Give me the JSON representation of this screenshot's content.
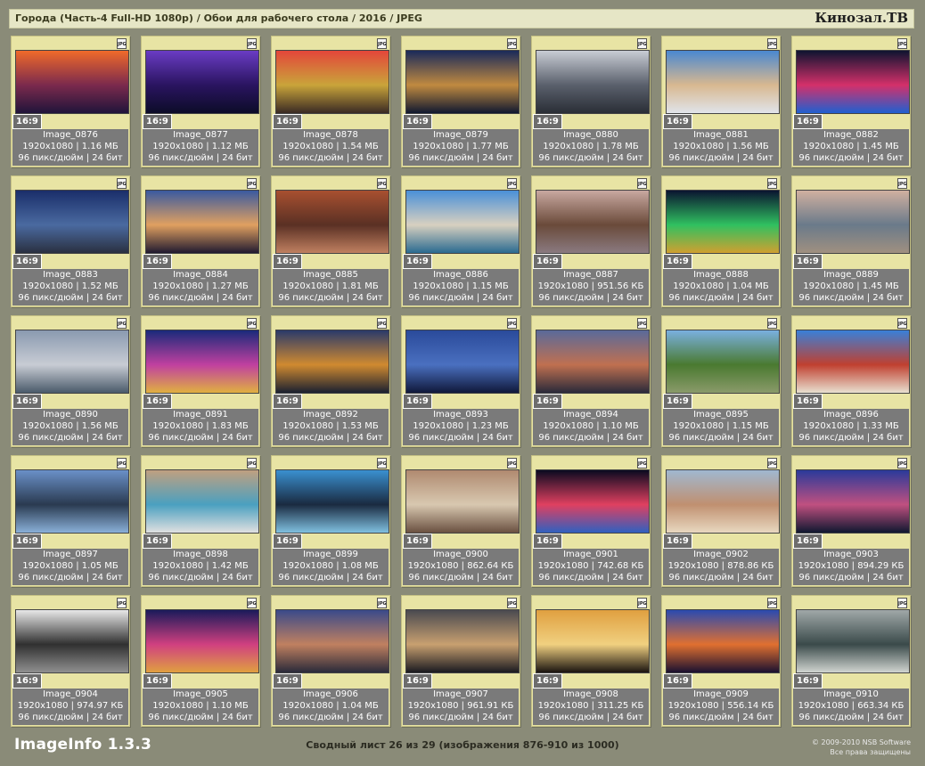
{
  "header": {
    "title": "Города (Часть-4 Full-HD 1080p) / Обои для рабочего стола / 2016 / JPEG",
    "brand": "Кинозал.ТВ"
  },
  "icon_label": "JPG",
  "items": [
    {
      "name": "Image_0876",
      "size": "1920x1080 | 1.16 МБ",
      "dpi": "96 пикс/дюйм | 24 бит",
      "ratio": "16:9",
      "colors": [
        "#f06a2a",
        "#7b2a4d",
        "#20143a"
      ]
    },
    {
      "name": "Image_0877",
      "size": "1920x1080 | 1.12 МБ",
      "dpi": "96 пикс/дюйм | 24 бит",
      "ratio": "16:9",
      "colors": [
        "#6a3cc4",
        "#2a1460",
        "#0c0c28"
      ]
    },
    {
      "name": "Image_0878",
      "size": "1920x1080 | 1.54 МБ",
      "dpi": "96 пикс/дюйм | 24 бит",
      "ratio": "16:9",
      "colors": [
        "#e4463a",
        "#c9a43a",
        "#3a2a24"
      ]
    },
    {
      "name": "Image_0879",
      "size": "1920x1080 | 1.77 МБ",
      "dpi": "96 пикс/дюйм | 24 бит",
      "ratio": "16:9",
      "colors": [
        "#1a2a5a",
        "#c08a40",
        "#101830"
      ]
    },
    {
      "name": "Image_0880",
      "size": "1920x1080 | 1.78 МБ",
      "dpi": "96 пикс/дюйм | 24 бит",
      "ratio": "16:9",
      "colors": [
        "#c8ccd4",
        "#5a606c",
        "#2a2e36"
      ]
    },
    {
      "name": "Image_0881",
      "size": "1920x1080 | 1.56 МБ",
      "dpi": "96 пикс/дюйм | 24 бит",
      "ratio": "16:9",
      "colors": [
        "#4a88d0",
        "#d8b890",
        "#e0e4ea"
      ]
    },
    {
      "name": "Image_0882",
      "size": "1920x1080 | 1.45 МБ",
      "dpi": "96 пикс/дюйм | 24 бит",
      "ratio": "16:9",
      "colors": [
        "#0e1430",
        "#d4306a",
        "#2060d0"
      ]
    },
    {
      "name": "Image_0883",
      "size": "1920x1080 | 1.52 МБ",
      "dpi": "96 пикс/дюйм | 24 бит",
      "ratio": "16:9",
      "colors": [
        "#1a2e6a",
        "#4a6aa0",
        "#2a3040"
      ]
    },
    {
      "name": "Image_0884",
      "size": "1920x1080 | 1.27 МБ",
      "dpi": "96 пикс/дюйм | 24 бит",
      "ratio": "16:9",
      "colors": [
        "#3a5aa0",
        "#e0a060",
        "#201a30"
      ]
    },
    {
      "name": "Image_0885",
      "size": "1920x1080 | 1.81 МБ",
      "dpi": "96 пикс/дюйм | 24 бит",
      "ratio": "16:9",
      "colors": [
        "#a85030",
        "#5a3024",
        "#c08060"
      ]
    },
    {
      "name": "Image_0886",
      "size": "1920x1080 | 1.15 МБ",
      "dpi": "96 пикс/дюйм | 24 бит",
      "ratio": "16:9",
      "colors": [
        "#4a90d8",
        "#d8d0c0",
        "#2a6a90"
      ]
    },
    {
      "name": "Image_0887",
      "size": "1920x1080 | 951.56 КБ",
      "dpi": "96 пикс/дюйм | 24 бит",
      "ratio": "16:9",
      "colors": [
        "#c8a8a0",
        "#6a4a3a",
        "#8a7a80"
      ]
    },
    {
      "name": "Image_0888",
      "size": "1920x1080 | 1.04 МБ",
      "dpi": "96 пикс/дюйм | 24 бит",
      "ratio": "16:9",
      "colors": [
        "#0a1430",
        "#30c060",
        "#d0a030"
      ]
    },
    {
      "name": "Image_0889",
      "size": "1920x1080 | 1.45 МБ",
      "dpi": "96 пикс/дюйм | 24 бит",
      "ratio": "16:9",
      "colors": [
        "#d0b0a0",
        "#6a7a8a",
        "#a09080"
      ]
    },
    {
      "name": "Image_0890",
      "size": "1920x1080 | 1.56 МБ",
      "dpi": "96 пикс/дюйм | 24 бит",
      "ratio": "16:9",
      "colors": [
        "#8a9ab0",
        "#c8ccd4",
        "#4a5a6a"
      ]
    },
    {
      "name": "Image_0891",
      "size": "1920x1080 | 1.83 МБ",
      "dpi": "96 пикс/дюйм | 24 бит",
      "ratio": "16:9",
      "colors": [
        "#1a2a7a",
        "#c040a0",
        "#e0b040"
      ]
    },
    {
      "name": "Image_0892",
      "size": "1920x1080 | 1.53 МБ",
      "dpi": "96 пикс/дюйм | 24 бит",
      "ratio": "16:9",
      "colors": [
        "#2a3a6a",
        "#d08a30",
        "#1a2030"
      ]
    },
    {
      "name": "Image_0893",
      "size": "1920x1080 | 1.23 МБ",
      "dpi": "96 пикс/дюйм | 24 бит",
      "ratio": "16:9",
      "colors": [
        "#2a4a9a",
        "#4a70c0",
        "#10183a"
      ]
    },
    {
      "name": "Image_0894",
      "size": "1920x1080 | 1.10 МБ",
      "dpi": "96 пикс/дюйм | 24 бит",
      "ratio": "16:9",
      "colors": [
        "#5a6a9a",
        "#c07050",
        "#2a2a3a"
      ]
    },
    {
      "name": "Image_0895",
      "size": "1920x1080 | 1.15 МБ",
      "dpi": "96 пикс/дюйм | 24 бит",
      "ratio": "16:9",
      "colors": [
        "#7ab0e0",
        "#4a7a30",
        "#8a9a6a"
      ]
    },
    {
      "name": "Image_0896",
      "size": "1920x1080 | 1.33 МБ",
      "dpi": "96 пикс/дюйм | 24 бит",
      "ratio": "16:9",
      "colors": [
        "#3a80d8",
        "#c04030",
        "#e8e0d0"
      ]
    },
    {
      "name": "Image_0897",
      "size": "1920x1080 | 1.05 МБ",
      "dpi": "96 пикс/дюйм | 24 бит",
      "ratio": "16:9",
      "colors": [
        "#6a90c8",
        "#2a3a50",
        "#8ab0d8"
      ]
    },
    {
      "name": "Image_0898",
      "size": "1920x1080 | 1.42 МБ",
      "dpi": "96 пикс/дюйм | 24 бит",
      "ratio": "16:9",
      "colors": [
        "#c0a080",
        "#4aa0c0",
        "#e0e0e0"
      ]
    },
    {
      "name": "Image_0899",
      "size": "1920x1080 | 1.08 МБ",
      "dpi": "96 пикс/дюйм | 24 бит",
      "ratio": "16:9",
      "colors": [
        "#3a90d0",
        "#1a2a40",
        "#80c0e0"
      ]
    },
    {
      "name": "Image_0900",
      "size": "1920x1080 | 862.64 КБ",
      "dpi": "96 пикс/дюйм | 24 бит",
      "ratio": "16:9",
      "colors": [
        "#b08a70",
        "#d8c8b0",
        "#6a5040"
      ]
    },
    {
      "name": "Image_0901",
      "size": "1920x1080 | 742.68 КБ",
      "dpi": "96 пикс/дюйм | 24 бит",
      "ratio": "16:9",
      "colors": [
        "#0a0a20",
        "#e04060",
        "#3060c0"
      ]
    },
    {
      "name": "Image_0902",
      "size": "1920x1080 | 878.86 КБ",
      "dpi": "96 пикс/дюйм | 24 бит",
      "ratio": "16:9",
      "colors": [
        "#a0b8d0",
        "#c09070",
        "#e8d8c0"
      ]
    },
    {
      "name": "Image_0903",
      "size": "1920x1080 | 894.29 КБ",
      "dpi": "96 пикс/дюйм | 24 бит",
      "ratio": "16:9",
      "colors": [
        "#2a3a9a",
        "#c05080",
        "#101830"
      ]
    },
    {
      "name": "Image_0904",
      "size": "1920x1080 | 974.97 КБ",
      "dpi": "96 пикс/дюйм | 24 бит",
      "ratio": "16:9",
      "colors": [
        "#e8e8e8",
        "#303030",
        "#909090"
      ]
    },
    {
      "name": "Image_0905",
      "size": "1920x1080 | 1.10 МБ",
      "dpi": "96 пикс/дюйм | 24 бит",
      "ratio": "16:9",
      "colors": [
        "#1a1a5a",
        "#d04080",
        "#e0a040"
      ]
    },
    {
      "name": "Image_0906",
      "size": "1920x1080 | 1.04 МБ",
      "dpi": "96 пикс/дюйм | 24 бит",
      "ratio": "16:9",
      "colors": [
        "#3a4a8a",
        "#c08060",
        "#2a2a3a"
      ]
    },
    {
      "name": "Image_0907",
      "size": "1920x1080 | 961.91 КБ",
      "dpi": "96 пикс/дюйм | 24 бит",
      "ratio": "16:9",
      "colors": [
        "#4a4a50",
        "#c8a070",
        "#1a1a20"
      ]
    },
    {
      "name": "Image_0908",
      "size": "1920x1080 | 311.25 КБ",
      "dpi": "96 пикс/дюйм | 24 бит",
      "ratio": "16:9",
      "colors": [
        "#e0a040",
        "#f0d080",
        "#1a1410"
      ]
    },
    {
      "name": "Image_0909",
      "size": "1920x1080 | 556.14 КБ",
      "dpi": "96 пикс/дюйм | 24 бит",
      "ratio": "16:9",
      "colors": [
        "#2a4ab0",
        "#e07030",
        "#1a1030"
      ]
    },
    {
      "name": "Image_0910",
      "size": "1920x1080 | 663.34 КБ",
      "dpi": "96 пикс/дюйм | 24 бит",
      "ratio": "16:9",
      "colors": [
        "#a0a8a8",
        "#3a4a4a",
        "#d0d4d0"
      ]
    }
  ],
  "footer": {
    "app_name": "ImageInfo 1.3.3",
    "status": "Сводный лист 26 из 29 (изображения 876-910 из 1000)",
    "copyright_line1": "© 2009-2010 NSB Software",
    "copyright_line2": "Все права защищены"
  }
}
